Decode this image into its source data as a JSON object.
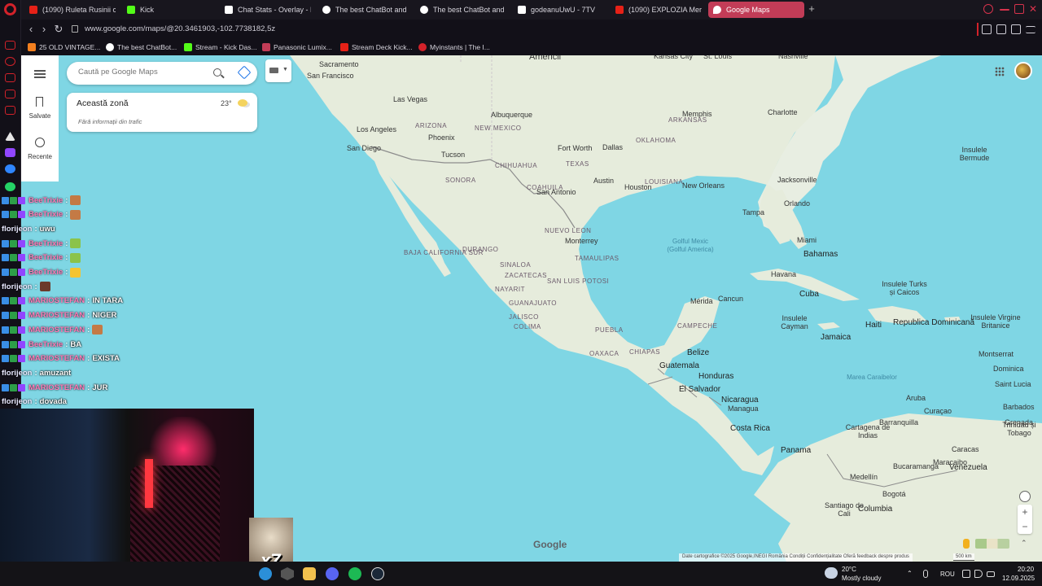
{
  "tabs": [
    {
      "label": "(1090) Ruleta Rusinii cu J",
      "color": "#e62117"
    },
    {
      "label": "Kick",
      "color": "#53fc18"
    },
    {
      "label": "Chat Stats - Overlay - Kic",
      "color": "#ffffff"
    },
    {
      "label": "The best ChatBot and W",
      "color": "#ffffff"
    },
    {
      "label": "The best ChatBot and W",
      "color": "#ffffff"
    },
    {
      "label": "godeanuUwU - 7TV",
      "color": "#ffffff"
    },
    {
      "label": "(1090) EXPLOZIA Merced",
      "color": "#e62117"
    },
    {
      "label": "Google Maps",
      "color": "#ea4335",
      "active": true
    }
  ],
  "address": {
    "url": "www.google.com/maps/@20.3461903,-102.7738182,5z"
  },
  "bookmarks": [
    {
      "label": "25 OLD VINTAGE...",
      "color": "#f4801f"
    },
    {
      "label": "The best ChatBot...",
      "color": "#ffffff"
    },
    {
      "label": "Stream - Kick Das...",
      "color": "#53fc18"
    },
    {
      "label": "Panasonic Lumix...",
      "color": "#c23c57"
    },
    {
      "label": "Stream Deck Kick...",
      "color": "#e62117"
    },
    {
      "label": "Myinstants | The I...",
      "color": "#d3222a"
    }
  ],
  "maps": {
    "search_placeholder": "Caută pe Google Maps",
    "saved_label": "Salvate",
    "recent_label": "Recente",
    "zone_title": "Această zonă",
    "zone_temp": "23°",
    "zone_traffic": "Fără informații din trafic",
    "zoom_in": "+",
    "zoom_out": "−",
    "logo": "Google",
    "attribution": "Date cartografice ©2025 Google,INEGI   România   Condiții   Confidențialitate   Oferă feedback despre produs",
    "scale": "500 km"
  },
  "map_labels": [
    {
      "t": "Americii",
      "k": "big"
    },
    {
      "t": "Sacramento",
      "k": "city"
    },
    {
      "t": "San Francisco",
      "k": "city"
    },
    {
      "t": "Las Vegas",
      "k": "city"
    },
    {
      "t": "Albuquerque",
      "k": "city"
    },
    {
      "t": "ARIZONA",
      "k": "country"
    },
    {
      "t": "NEW MEXICO",
      "k": "country"
    },
    {
      "t": "Los Angeles",
      "k": "city"
    },
    {
      "t": "Phoenix",
      "k": "city"
    },
    {
      "t": "San Diego",
      "k": "city"
    },
    {
      "t": "Tucson",
      "k": "city"
    },
    {
      "t": "Kansas City",
      "k": "city"
    },
    {
      "t": "St. Louis",
      "k": "city"
    },
    {
      "t": "Nashville",
      "k": "city"
    },
    {
      "t": "Memphis",
      "k": "city"
    },
    {
      "t": "Charlotte",
      "k": "city"
    },
    {
      "t": "ARKANSAS",
      "k": "country"
    },
    {
      "t": "OKLAHOMA",
      "k": "country"
    },
    {
      "t": "Fort Worth",
      "k": "city"
    },
    {
      "t": "Dallas",
      "k": "city"
    },
    {
      "t": "TEXAS",
      "k": "country"
    },
    {
      "t": "Austin",
      "k": "city"
    },
    {
      "t": "Houston",
      "k": "city"
    },
    {
      "t": "LOUISIANA",
      "k": "country"
    },
    {
      "t": "New Orleans",
      "k": "city"
    },
    {
      "t": "Jacksonville",
      "k": "city"
    },
    {
      "t": "Orlando",
      "k": "city"
    },
    {
      "t": "Tampa",
      "k": "city"
    },
    {
      "t": "Miami",
      "k": "city"
    },
    {
      "t": "Bahamas",
      "k": "capital"
    },
    {
      "t": "Insulele Bermude",
      "k": "city"
    },
    {
      "t": "San Antonio",
      "k": "city"
    },
    {
      "t": "SONORA",
      "k": "country"
    },
    {
      "t": "CHIHUAHUA",
      "k": "country"
    },
    {
      "t": "COAHUILA",
      "k": "country"
    },
    {
      "t": "NUEVO LEON",
      "k": "country"
    },
    {
      "t": "Monterrey",
      "k": "city"
    },
    {
      "t": "TAMAULIPAS",
      "k": "country"
    },
    {
      "t": "BAJA CALIFORNIA SUR",
      "k": "country"
    },
    {
      "t": "DURANGO",
      "k": "country"
    },
    {
      "t": "SINALOA",
      "k": "country"
    },
    {
      "t": "ZACATECAS",
      "k": "country"
    },
    {
      "t": "SAN LUIS POTOSI",
      "k": "country"
    },
    {
      "t": "NAYARIT",
      "k": "country"
    },
    {
      "t": "GUANAJUATO",
      "k": "country"
    },
    {
      "t": "JALISCO",
      "k": "country"
    },
    {
      "t": "COLIMA",
      "k": "country"
    },
    {
      "t": "PUEBLA",
      "k": "country"
    },
    {
      "t": "OAXACA",
      "k": "country"
    },
    {
      "t": "CHIAPAS",
      "k": "country"
    },
    {
      "t": "Golful Mexic (Golful America)",
      "k": "water"
    },
    {
      "t": "Mérida",
      "k": "city"
    },
    {
      "t": "Cancun",
      "k": "city"
    },
    {
      "t": "CAMPECHE",
      "k": "country"
    },
    {
      "t": "Havana",
      "k": "city"
    },
    {
      "t": "Cuba",
      "k": "capital"
    },
    {
      "t": "Insulele Turks și Caicos",
      "k": "city"
    },
    {
      "t": "Insulele Cayman",
      "k": "city"
    },
    {
      "t": "Jamaica",
      "k": "capital"
    },
    {
      "t": "Haiti",
      "k": "capital"
    },
    {
      "t": "Republica Dominicană",
      "k": "capital"
    },
    {
      "t": "Insulele Virgine Britanice",
      "k": "city"
    },
    {
      "t": "Belize",
      "k": "capital"
    },
    {
      "t": "Guatemala",
      "k": "capital"
    },
    {
      "t": "Honduras",
      "k": "capital"
    },
    {
      "t": "El Salvador",
      "k": "capital"
    },
    {
      "t": "Nicaragua",
      "k": "capital"
    },
    {
      "t": "Managua",
      "k": "city"
    },
    {
      "t": "Costa Rica",
      "k": "capital"
    },
    {
      "t": "Panama",
      "k": "capital"
    },
    {
      "t": "Marea Caraibelor",
      "k": "water"
    },
    {
      "t": "Montserrat",
      "k": "city"
    },
    {
      "t": "Dominica",
      "k": "city"
    },
    {
      "t": "Saint Lucia",
      "k": "city"
    },
    {
      "t": "Barbados",
      "k": "city"
    },
    {
      "t": "Grenada",
      "k": "city"
    },
    {
      "t": "Aruba",
      "k": "city"
    },
    {
      "t": "Curaçao",
      "k": "city"
    },
    {
      "t": "Trinidad și Tobago",
      "k": "city"
    },
    {
      "t": "Barranquilla",
      "k": "city"
    },
    {
      "t": "Cartagena de Indias",
      "k": "city"
    },
    {
      "t": "Maracaibo",
      "k": "city"
    },
    {
      "t": "Caracas",
      "k": "city"
    },
    {
      "t": "Venezuela",
      "k": "capital"
    },
    {
      "t": "Medellín",
      "k": "city"
    },
    {
      "t": "Bucaramanga",
      "k": "city"
    },
    {
      "t": "Bogotá",
      "k": "city"
    },
    {
      "t": "Columbia",
      "k": "capital"
    },
    {
      "t": "Santiago de Cali",
      "k": "city"
    }
  ],
  "chat": [
    {
      "user": "BeeTrixie",
      "msg": "",
      "emote": "#c47a45",
      "ucolor": "#ff7ab8"
    },
    {
      "user": "BeeTrixie",
      "msg": "",
      "emote": "#c47a45",
      "ucolor": "#ff7ab8"
    },
    {
      "user": "florijeon",
      "msg": "uwu",
      "emote": "",
      "ucolor": "#e8e8ff"
    },
    {
      "user": "BeeTrixie",
      "msg": "",
      "emote": "#8bc34a",
      "ucolor": "#ff7ab8"
    },
    {
      "user": "BeeTrixie",
      "msg": "",
      "emote": "#8bc34a",
      "ucolor": "#ff7ab8"
    },
    {
      "user": "BeeTrixie",
      "msg": "",
      "emote": "#f4c430",
      "ucolor": "#ff7ab8"
    },
    {
      "user": "florijeon",
      "msg": "",
      "emote": "#6b3a2a",
      "ucolor": "#e8e8ff"
    },
    {
      "user": "MARIOSTEFAN",
      "msg": "IN TARA",
      "emote": "",
      "ucolor": "#ff7ab8"
    },
    {
      "user": "MARIOSTEFAN",
      "msg": "NIGER",
      "emote": "",
      "ucolor": "#ff7ab8"
    },
    {
      "user": "MARIOSTEFAN",
      "msg": "",
      "emote": "#c47a45",
      "ucolor": "#ff7ab8"
    },
    {
      "user": "BeeTrixie",
      "msg": "BA",
      "emote": "",
      "ucolor": "#ff7ab8"
    },
    {
      "user": "MARIOSTEFAN",
      "msg": "EXISTA",
      "emote": "",
      "ucolor": "#ff7ab8"
    },
    {
      "user": "florijeon",
      "msg": "amuzant",
      "emote": "",
      "ucolor": "#e8e8ff"
    },
    {
      "user": "MARIOSTEFAN",
      "msg": "JUR",
      "emote": "",
      "ucolor": "#ff7ab8"
    },
    {
      "user": "florijeon",
      "msg": "dovada",
      "emote": "",
      "ucolor": "#e8e8ff"
    }
  ],
  "overlay": {
    "cat_count": "x7"
  },
  "taskbar": {
    "temperature": "20°C",
    "weather": "Mostly cloudy",
    "lang": "ROU",
    "time": "20:20",
    "date": "12.09.2025"
  }
}
